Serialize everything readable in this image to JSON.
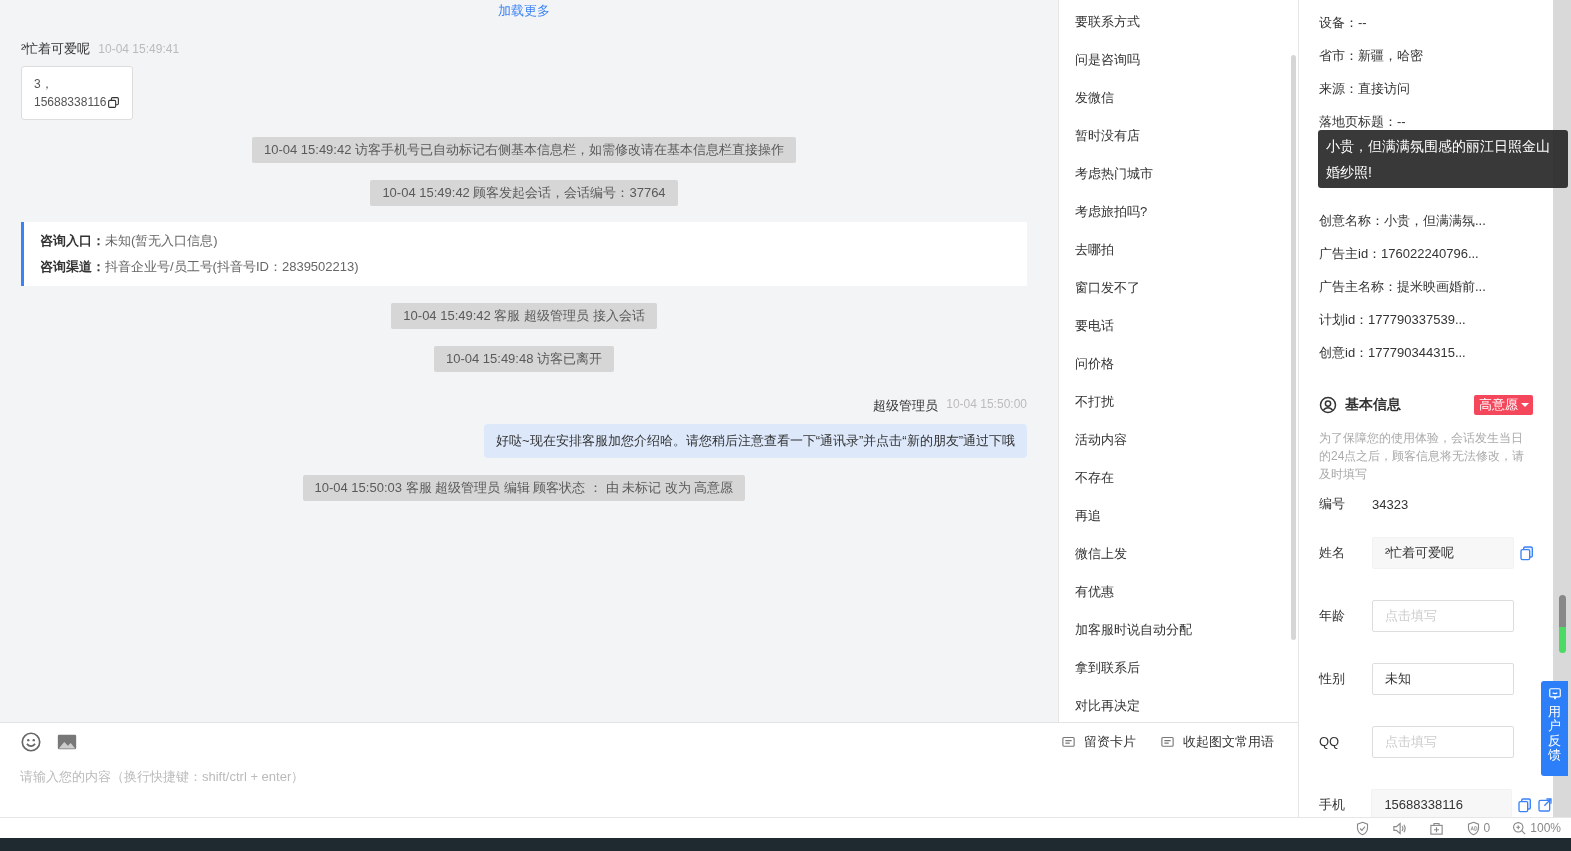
{
  "chat": {
    "load_more": "加载更多",
    "messages": [
      {
        "kind": "visitor",
        "sender": "²忙着可爱呢",
        "time": "10-04 15:49:41",
        "lines": [
          "3，",
          "15688338116"
        ]
      },
      {
        "kind": "system",
        "text": "10-04 15:49:42 访客手机号已自动标记右侧基本信息栏，如需修改请在基本信息栏直接操作"
      },
      {
        "kind": "system",
        "text": "10-04 15:49:42 顾客发起会话，会话编号：37764"
      },
      {
        "kind": "entry",
        "rows": [
          {
            "label": "咨询入口：",
            "value": "未知(暂无入口信息)"
          },
          {
            "label": "咨询渠道：",
            "value": "抖音企业号/员工号(抖音号ID：2839502213)"
          }
        ]
      },
      {
        "kind": "system",
        "text": "10-04 15:49:42 客服 超级管理员 接入会话"
      },
      {
        "kind": "system",
        "text": "10-04 15:49:48 访客已离开"
      },
      {
        "kind": "agent",
        "sender": "超级管理员",
        "time": "10-04 15:50:00",
        "text": "好哒~现在安排客服加您介绍哈。请您稍后注意查看一下“通讯录”并点击“新的朋友”通过下哦"
      },
      {
        "kind": "system",
        "text": "10-04 15:50:03 客服 超级管理员 编辑 顾客状态 ： 由 未标记 改为 高意愿"
      }
    ]
  },
  "composer": {
    "placeholder": "请输入您的内容（换行快捷键：shift/ctrl + enter）",
    "actions": [
      "留资卡片",
      "收起图文常用语"
    ]
  },
  "quick_replies": [
    "要联系方式",
    "问是咨询吗",
    "发微信",
    "暂时没有店",
    "考虑热门城市",
    "考虑旅拍吗?",
    "去哪拍",
    "窗口发不了",
    "要电话",
    "问价格",
    "不打扰",
    "活动内容",
    "不存在",
    "再追",
    "微信上发",
    "有优惠",
    "加客服时说自动分配",
    "拿到联系后",
    "对比再决定"
  ],
  "visitor_info": {
    "rows_top": [
      "设备：--",
      "省市：新疆，哈密",
      "来源：直接访问",
      "落地页标题：--"
    ],
    "tooltip": "小贵，但满满氛围感的丽江日照金山婚纱照!",
    "rows_bottom": [
      "创意名称：小贵，但满满氛...",
      "广告主id：176022240796...",
      "广告主名称：提米映画婚前...",
      "计划id：177790337539...",
      "创意id：177790344315..."
    ]
  },
  "basic_info": {
    "title": "基本信息",
    "intent": "高意愿",
    "notice": "为了保障您的使用体验，会话发生当日的24点之后，顾客信息将无法修改，请及时填写",
    "fields": [
      {
        "label": "编号",
        "kind": "text",
        "value": "34323"
      },
      {
        "label": "姓名",
        "kind": "readonly",
        "value": "²忙着可爱呢",
        "copy": true
      },
      {
        "label": "年龄",
        "kind": "input",
        "placeholder": "点击填写"
      },
      {
        "label": "性别",
        "kind": "input",
        "value": "未知"
      },
      {
        "label": "QQ",
        "kind": "input",
        "placeholder": "点击填写"
      },
      {
        "label": "手机",
        "kind": "readonly",
        "value": "15688338116",
        "copy": true,
        "link": true
      }
    ]
  },
  "feedback": "用户反馈",
  "status_bar": {
    "ad_count": "0",
    "zoom": "100%"
  }
}
